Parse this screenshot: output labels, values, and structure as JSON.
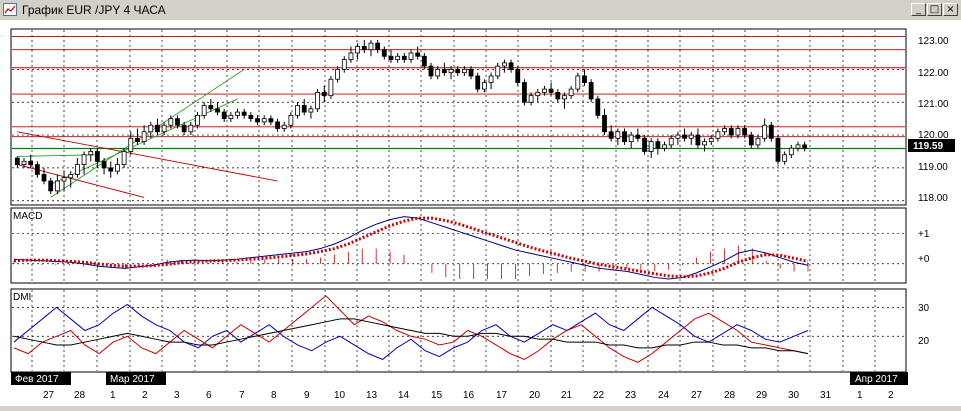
{
  "window": {
    "title": "График EUR /JPY  4 ЧАСА",
    "min_glyph": "_",
    "max_glyph": "□",
    "close_glyph": "×"
  },
  "price_panel": {
    "current_price": "119.59",
    "y_labels": [
      "123.00",
      "122.00",
      "121.00",
      "120.00",
      "119.00",
      "118.00"
    ],
    "colors": {
      "bull": "#000000",
      "bear": "#000000",
      "hline": "#c00000",
      "support": "#008000",
      "channel": "#33a033",
      "trend": "#c00000"
    }
  },
  "macd_panel": {
    "title": "MACD",
    "y_labels": [
      "+1",
      "+0"
    ],
    "colors": {
      "macd": "#000080",
      "signal": "#cc0000",
      "hist": "#cc0000"
    }
  },
  "dmi_panel": {
    "title": "DMI",
    "y_labels": [
      "30",
      "20"
    ],
    "colors": {
      "plus": "#0000c0",
      "minus": "#cc0000",
      "adx": "#000000"
    }
  },
  "time_axis": {
    "months": [
      "Фев 2017",
      "Мар 2017",
      "Апр 2017"
    ],
    "days": [
      "27",
      "28",
      "1",
      "2",
      "3",
      "6",
      "7",
      "8",
      "9",
      "10",
      "13",
      "14",
      "15",
      "16",
      "17",
      "20",
      "21",
      "22",
      "23",
      "24",
      "27",
      "28",
      "29",
      "30",
      "31",
      "1",
      "2"
    ]
  },
  "chart_data": {
    "type": "candlestick",
    "symbol": "EUR/JPY",
    "timeframe": "4 ЧАСА",
    "ylim": [
      117.9,
      123.2
    ],
    "current_price": 119.59,
    "ohlc": [
      [
        119.3,
        119.35,
        119.0,
        119.1
      ],
      [
        119.1,
        119.3,
        119.0,
        119.2
      ],
      [
        119.2,
        119.4,
        119.0,
        119.1
      ],
      [
        119.1,
        119.2,
        118.7,
        118.8
      ],
      [
        118.8,
        119.0,
        118.5,
        118.6
      ],
      [
        118.6,
        118.7,
        118.2,
        118.3
      ],
      [
        118.3,
        118.8,
        118.2,
        118.6
      ],
      [
        118.6,
        118.9,
        118.3,
        118.7
      ],
      [
        118.7,
        118.9,
        118.4,
        118.8
      ],
      [
        118.8,
        119.3,
        118.7,
        119.1
      ],
      [
        119.1,
        119.5,
        118.8,
        119.4
      ],
      [
        119.4,
        119.6,
        119.2,
        119.5
      ],
      [
        119.5,
        119.6,
        119.0,
        119.2
      ],
      [
        119.2,
        119.3,
        118.8,
        119.0
      ],
      [
        119.0,
        119.2,
        118.7,
        118.9
      ],
      [
        118.9,
        119.3,
        118.8,
        119.1
      ],
      [
        119.1,
        119.6,
        119.0,
        119.5
      ],
      [
        119.5,
        120.1,
        119.4,
        119.9
      ],
      [
        119.9,
        120.2,
        119.7,
        119.8
      ],
      [
        119.8,
        120.3,
        119.7,
        120.1
      ],
      [
        120.1,
        120.4,
        119.9,
        120.3
      ],
      [
        120.3,
        120.5,
        120.0,
        120.1
      ],
      [
        120.1,
        120.4,
        120.0,
        120.3
      ],
      [
        120.3,
        120.6,
        120.2,
        120.5
      ],
      [
        120.5,
        120.6,
        120.2,
        120.3
      ],
      [
        120.3,
        120.4,
        120.0,
        120.1
      ],
      [
        120.1,
        120.4,
        120.0,
        120.3
      ],
      [
        120.3,
        120.7,
        120.2,
        120.6
      ],
      [
        120.6,
        121.0,
        120.5,
        120.9
      ],
      [
        120.9,
        121.1,
        120.7,
        120.8
      ],
      [
        120.8,
        121.0,
        120.6,
        120.7
      ],
      [
        120.7,
        120.8,
        120.4,
        120.5
      ],
      [
        120.5,
        120.7,
        120.4,
        120.6
      ],
      [
        120.6,
        120.8,
        120.5,
        120.7
      ],
      [
        120.7,
        120.8,
        120.5,
        120.6
      ],
      [
        120.6,
        120.7,
        120.4,
        120.5
      ],
      [
        120.5,
        120.6,
        120.3,
        120.4
      ],
      [
        120.4,
        120.6,
        120.3,
        120.5
      ],
      [
        120.5,
        120.6,
        120.3,
        120.4
      ],
      [
        120.4,
        120.5,
        120.1,
        120.2
      ],
      [
        120.2,
        120.4,
        120.1,
        120.3
      ],
      [
        120.3,
        120.7,
        120.2,
        120.6
      ],
      [
        120.6,
        121.0,
        120.5,
        120.9
      ],
      [
        120.9,
        121.1,
        120.6,
        120.7
      ],
      [
        120.7,
        120.9,
        120.5,
        120.8
      ],
      [
        120.8,
        121.4,
        120.7,
        121.3
      ],
      [
        121.3,
        121.5,
        121.0,
        121.2
      ],
      [
        121.2,
        121.8,
        121.1,
        121.7
      ],
      [
        121.7,
        122.1,
        121.6,
        122.0
      ],
      [
        122.0,
        122.4,
        121.9,
        122.3
      ],
      [
        122.3,
        122.7,
        122.2,
        122.5
      ],
      [
        122.5,
        122.8,
        122.3,
        122.7
      ],
      [
        122.7,
        122.9,
        122.5,
        122.6
      ],
      [
        122.6,
        122.9,
        122.4,
        122.8
      ],
      [
        122.8,
        122.9,
        122.5,
        122.6
      ],
      [
        122.6,
        122.7,
        122.3,
        122.4
      ],
      [
        122.4,
        122.6,
        122.2,
        122.3
      ],
      [
        122.3,
        122.5,
        122.2,
        122.4
      ],
      [
        122.4,
        122.5,
        122.2,
        122.3
      ],
      [
        122.3,
        122.6,
        122.2,
        122.5
      ],
      [
        122.5,
        122.7,
        122.3,
        122.4
      ],
      [
        122.4,
        122.5,
        122.0,
        122.1
      ],
      [
        122.1,
        122.2,
        121.7,
        121.8
      ],
      [
        121.8,
        122.1,
        121.7,
        122.0
      ],
      [
        122.0,
        122.2,
        121.8,
        121.9
      ],
      [
        121.9,
        122.1,
        121.7,
        122.0
      ],
      [
        122.0,
        122.1,
        121.8,
        121.9
      ],
      [
        121.9,
        122.1,
        121.8,
        122.0
      ],
      [
        122.0,
        122.1,
        121.7,
        121.8
      ],
      [
        121.8,
        121.9,
        121.3,
        121.4
      ],
      [
        121.4,
        121.7,
        121.3,
        121.6
      ],
      [
        121.6,
        121.9,
        121.4,
        121.8
      ],
      [
        121.8,
        122.2,
        121.7,
        122.1
      ],
      [
        122.1,
        122.3,
        121.9,
        122.2
      ],
      [
        122.2,
        122.3,
        121.9,
        122.0
      ],
      [
        122.0,
        122.1,
        121.5,
        121.6
      ],
      [
        121.6,
        121.7,
        120.9,
        121.0
      ],
      [
        121.0,
        121.3,
        120.9,
        121.2
      ],
      [
        121.2,
        121.4,
        121.0,
        121.3
      ],
      [
        121.3,
        121.5,
        121.2,
        121.4
      ],
      [
        121.4,
        121.6,
        121.2,
        121.3
      ],
      [
        121.3,
        121.4,
        121.0,
        121.1
      ],
      [
        121.1,
        121.3,
        120.8,
        121.2
      ],
      [
        121.2,
        121.5,
        121.1,
        121.4
      ],
      [
        121.4,
        121.9,
        121.3,
        121.8
      ],
      [
        121.8,
        122.0,
        121.5,
        121.6
      ],
      [
        121.6,
        121.7,
        121.0,
        121.1
      ],
      [
        121.1,
        121.2,
        120.5,
        120.6
      ],
      [
        120.6,
        120.8,
        120.0,
        120.1
      ],
      [
        120.1,
        120.3,
        119.8,
        119.9
      ],
      [
        119.9,
        120.2,
        119.7,
        120.1
      ],
      [
        120.1,
        120.2,
        119.7,
        119.8
      ],
      [
        119.8,
        120.1,
        119.6,
        120.0
      ],
      [
        120.0,
        120.2,
        119.8,
        119.9
      ],
      [
        119.9,
        120.0,
        119.4,
        119.5
      ],
      [
        119.5,
        119.9,
        119.3,
        119.8
      ],
      [
        119.8,
        119.9,
        119.4,
        119.6
      ],
      [
        119.6,
        119.8,
        119.5,
        119.7
      ],
      [
        119.7,
        120.0,
        119.6,
        119.9
      ],
      [
        119.9,
        120.1,
        119.7,
        120.0
      ],
      [
        120.0,
        120.2,
        119.8,
        119.9
      ],
      [
        119.9,
        120.1,
        119.7,
        120.0
      ],
      [
        120.0,
        120.2,
        119.6,
        119.7
      ],
      [
        119.7,
        119.9,
        119.5,
        119.8
      ],
      [
        119.8,
        120.0,
        119.7,
        119.9
      ],
      [
        119.9,
        120.2,
        119.8,
        120.1
      ],
      [
        120.1,
        120.3,
        120.0,
        120.2
      ],
      [
        120.2,
        120.3,
        119.9,
        120.0
      ],
      [
        120.0,
        120.3,
        119.9,
        120.2
      ],
      [
        120.2,
        120.3,
        119.9,
        120.0
      ],
      [
        120.0,
        120.1,
        119.6,
        119.7
      ],
      [
        119.7,
        120.0,
        119.6,
        119.9
      ],
      [
        119.9,
        120.5,
        119.8,
        120.3
      ],
      [
        120.3,
        120.4,
        119.8,
        119.9
      ],
      [
        119.9,
        120.0,
        119.1,
        119.2
      ],
      [
        119.2,
        119.5,
        119.1,
        119.4
      ],
      [
        119.4,
        119.7,
        119.3,
        119.6
      ],
      [
        119.6,
        119.8,
        119.5,
        119.7
      ],
      [
        119.7,
        119.8,
        119.5,
        119.59
      ]
    ],
    "support_level": 119.59,
    "resistance_levels": [
      123.0,
      122.6,
      122.05,
      121.25,
      120.25,
      119.95
    ],
    "macd": {
      "ylim": [
        -0.6,
        1.8
      ],
      "macd_line": [
        0.15,
        0.12,
        0.1,
        0.08,
        0.05,
        0.0,
        -0.08,
        -0.12,
        -0.15,
        -0.1,
        -0.05,
        0.05,
        0.1,
        0.12,
        0.1,
        0.12,
        0.15,
        0.2,
        0.25,
        0.3,
        0.35,
        0.4,
        0.5,
        0.65,
        0.85,
        1.1,
        1.3,
        1.45,
        1.55,
        1.5,
        1.35,
        1.2,
        1.05,
        0.9,
        0.75,
        0.6,
        0.45,
        0.35,
        0.25,
        0.15,
        0.05,
        -0.05,
        -0.15,
        -0.2,
        -0.25,
        -0.35,
        -0.45,
        -0.5,
        -0.45,
        -0.3,
        -0.1,
        0.1,
        0.35,
        0.45,
        0.35,
        0.2,
        0.05,
        -0.05
      ],
      "signal_line": [
        0.1,
        0.12,
        0.12,
        0.1,
        0.08,
        0.05,
        0.0,
        -0.05,
        -0.08,
        -0.08,
        -0.06,
        -0.02,
        0.03,
        0.07,
        0.09,
        0.1,
        0.12,
        0.15,
        0.18,
        0.22,
        0.27,
        0.32,
        0.4,
        0.5,
        0.65,
        0.85,
        1.05,
        1.25,
        1.4,
        1.5,
        1.5,
        1.42,
        1.3,
        1.15,
        1.0,
        0.85,
        0.7,
        0.55,
        0.42,
        0.3,
        0.18,
        0.08,
        -0.02,
        -0.1,
        -0.17,
        -0.25,
        -0.33,
        -0.4,
        -0.43,
        -0.4,
        -0.3,
        -0.15,
        0.05,
        0.2,
        0.3,
        0.28,
        0.18,
        0.08
      ]
    },
    "dmi": {
      "ylim": [
        8,
        36
      ],
      "plus_di": [
        18,
        22,
        26,
        30,
        26,
        22,
        24,
        28,
        31,
        27,
        24,
        22,
        18,
        16,
        20,
        22,
        18,
        21,
        24,
        20,
        17,
        15,
        18,
        20,
        17,
        14,
        12,
        16,
        19,
        15,
        13,
        16,
        18,
        22,
        24,
        20,
        18,
        21,
        24,
        22,
        25,
        28,
        24,
        22,
        26,
        30,
        27,
        24,
        20,
        18,
        21,
        24,
        22,
        19,
        18,
        20,
        22
      ],
      "minus_di": [
        16,
        14,
        18,
        20,
        22,
        17,
        14,
        18,
        20,
        16,
        14,
        18,
        22,
        19,
        16,
        20,
        24,
        21,
        18,
        22,
        26,
        30,
        34,
        29,
        24,
        27,
        25,
        22,
        20,
        19,
        17,
        18,
        22,
        20,
        17,
        14,
        12,
        15,
        19,
        22,
        24,
        20,
        16,
        13,
        11,
        14,
        18,
        22,
        26,
        28,
        25,
        22,
        18,
        17,
        16,
        15,
        14
      ],
      "adx": [
        20,
        19,
        18,
        17,
        17,
        18,
        19,
        20,
        21,
        20,
        19,
        18,
        18,
        17,
        17,
        18,
        19,
        20,
        21,
        22,
        23,
        24,
        25,
        26,
        26,
        25,
        24,
        23,
        22,
        21,
        21,
        20,
        20,
        21,
        21,
        20,
        20,
        19,
        19,
        18,
        18,
        18,
        17,
        17,
        16,
        16,
        17,
        17,
        18,
        18,
        17,
        17,
        16,
        16,
        15,
        15,
        14
      ]
    }
  }
}
